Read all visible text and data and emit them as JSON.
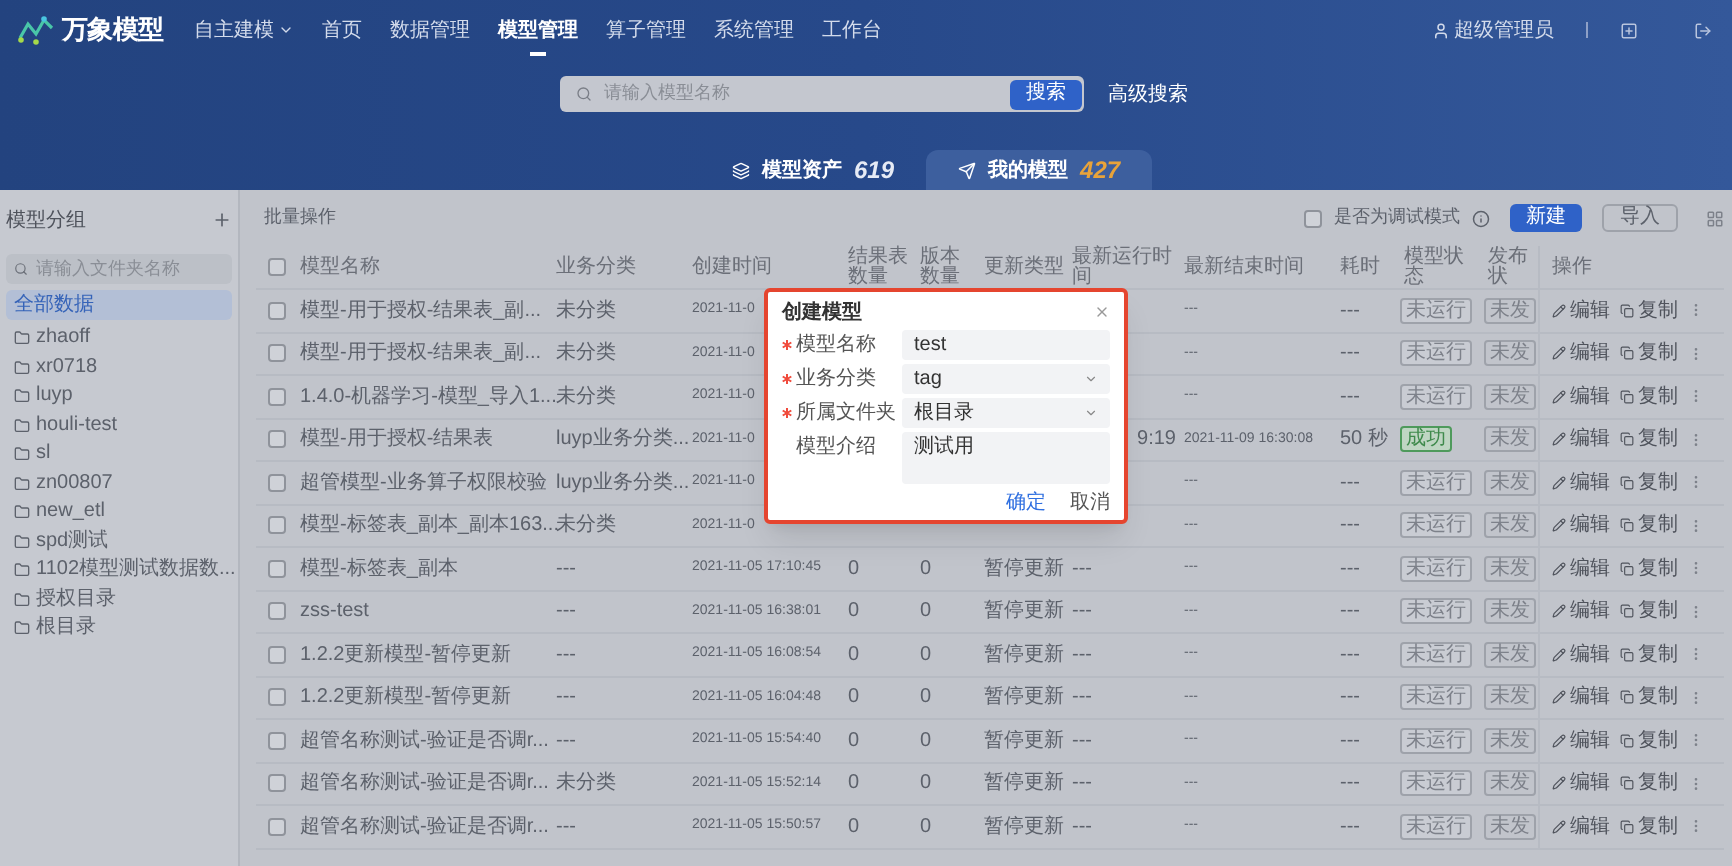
{
  "header": {
    "logo": "万象模型",
    "nav": [
      {
        "label": "自主建模",
        "dropdown": true,
        "selected": false
      },
      {
        "label": "首页",
        "dropdown": false,
        "selected": false
      },
      {
        "label": "数据管理",
        "dropdown": false,
        "selected": false
      },
      {
        "label": "模型管理",
        "dropdown": false,
        "selected": true
      },
      {
        "label": "算子管理",
        "dropdown": false,
        "selected": false
      },
      {
        "label": "系统管理",
        "dropdown": false,
        "selected": false
      },
      {
        "label": "工作台",
        "dropdown": false,
        "selected": false
      }
    ],
    "user": "超级管理员"
  },
  "search": {
    "placeholder": "请输入模型名称",
    "button": "搜索",
    "advanced": "高级搜索"
  },
  "asset_tabs": [
    {
      "label": "模型资产",
      "count": "619",
      "kind": "assets",
      "selected": false
    },
    {
      "label": "我的模型",
      "count": "427",
      "kind": "mine",
      "selected": true
    }
  ],
  "sidebar": {
    "title": "模型分组",
    "search_placeholder": "请输入文件夹名称",
    "items": [
      {
        "label": "全部数据",
        "kind": "all",
        "selected": true
      },
      {
        "label": "zhaoff",
        "kind": "folder",
        "selected": false
      },
      {
        "label": "xr0718",
        "kind": "folder",
        "selected": false
      },
      {
        "label": "luyp",
        "kind": "folder",
        "selected": false
      },
      {
        "label": "houli-test",
        "kind": "folder",
        "selected": false
      },
      {
        "label": "sl",
        "kind": "folder",
        "selected": false
      },
      {
        "label": "zn00807",
        "kind": "folder",
        "selected": false
      },
      {
        "label": "new_etl",
        "kind": "folder",
        "selected": false
      },
      {
        "label": "spd测试",
        "kind": "folder",
        "selected": false
      },
      {
        "label": "1102模型测试数据数...",
        "kind": "folder",
        "selected": false
      },
      {
        "label": "授权目录",
        "kind": "folder",
        "selected": false
      },
      {
        "label": "根目录",
        "kind": "folder",
        "selected": false
      }
    ]
  },
  "toolbar": {
    "batch": "批量操作",
    "debug_mode": {
      "label": "是否为调试模式",
      "checked": false
    },
    "buttons": [
      {
        "label": "新建",
        "kind": "primary"
      },
      {
        "label": "导入",
        "kind": "default"
      }
    ]
  },
  "table": {
    "all_checked": false,
    "columns": [
      "模型名称",
      "业务分类",
      "创建时间",
      "结果表数量",
      "版本数量",
      "更新类型",
      "最新运行时间",
      "最新结束时间",
      "耗时",
      "模型状态",
      "发布状",
      "操作"
    ],
    "rows": [
      {
        "checked": false,
        "name": "模型-用于授权-结果表_副...",
        "category": "未分类",
        "created": "2021-11-0",
        "last_end": "---",
        "duration": "---",
        "status": {
          "label": "未运行",
          "kind": "idle"
        },
        "publish": "未发",
        "actions": [
          "编辑",
          "复制"
        ]
      },
      {
        "checked": false,
        "name": "模型-用于授权-结果表_副...",
        "category": "未分类",
        "created": "2021-11-0",
        "last_end": "---",
        "duration": "---",
        "status": {
          "label": "未运行",
          "kind": "idle"
        },
        "publish": "未发",
        "actions": [
          "编辑",
          "复制"
        ]
      },
      {
        "checked": false,
        "name": "1.4.0-机器学习-模型_导入1...",
        "category": "未分类",
        "created": "2021-11-0",
        "last_end": "---",
        "duration": "---",
        "status": {
          "label": "未运行",
          "kind": "idle"
        },
        "publish": "未发",
        "actions": [
          "编辑",
          "复制"
        ]
      },
      {
        "checked": false,
        "name": "模型-用于授权-结果表",
        "category": "luyp业务分类...",
        "created": "2021-11-0",
        "last_run": "9:19",
        "last_end": "2021-11-09 16:30:08",
        "duration": "50 秒",
        "status": {
          "label": "成功",
          "kind": "success"
        },
        "publish": "未发",
        "actions": [
          "编辑",
          "复制"
        ]
      },
      {
        "checked": false,
        "name": "超管模型-业务算子权限校验",
        "category": "luyp业务分类...",
        "created": "2021-11-0",
        "last_end": "---",
        "duration": "---",
        "status": {
          "label": "未运行",
          "kind": "idle"
        },
        "publish": "未发",
        "actions": [
          "编辑",
          "复制"
        ]
      },
      {
        "checked": false,
        "name": "模型-标签表_副本_副本163...",
        "category": "未分类",
        "created": "2021-11-0",
        "last_end": "---",
        "duration": "---",
        "status": {
          "label": "未运行",
          "kind": "idle"
        },
        "publish": "未发",
        "actions": [
          "编辑",
          "复制"
        ]
      },
      {
        "checked": false,
        "name": "模型-标签表_副本",
        "category": "---",
        "created": "2021-11-05 17:10:45",
        "result_count": "0",
        "version_count": "0",
        "update_type": "暂停更新",
        "last_run": "---",
        "last_end": "---",
        "duration": "---",
        "status": {
          "label": "未运行",
          "kind": "idle"
        },
        "publish": "未发",
        "actions": [
          "编辑",
          "复制"
        ]
      },
      {
        "checked": false,
        "name": "zss-test",
        "category": "---",
        "created": "2021-11-05 16:38:01",
        "result_count": "0",
        "version_count": "0",
        "update_type": "暂停更新",
        "last_run": "---",
        "last_end": "---",
        "duration": "---",
        "status": {
          "label": "未运行",
          "kind": "idle"
        },
        "publish": "未发",
        "actions": [
          "编辑",
          "复制"
        ]
      },
      {
        "checked": false,
        "name": "1.2.2更新模型-暂停更新",
        "category": "---",
        "created": "2021-11-05 16:08:54",
        "result_count": "0",
        "version_count": "0",
        "update_type": "暂停更新",
        "last_run": "---",
        "last_end": "---",
        "duration": "---",
        "status": {
          "label": "未运行",
          "kind": "idle"
        },
        "publish": "未发",
        "actions": [
          "编辑",
          "复制"
        ]
      },
      {
        "checked": false,
        "name": "1.2.2更新模型-暂停更新",
        "category": "---",
        "created": "2021-11-05 16:04:48",
        "result_count": "0",
        "version_count": "0",
        "update_type": "暂停更新",
        "last_run": "---",
        "last_end": "---",
        "duration": "---",
        "status": {
          "label": "未运行",
          "kind": "idle"
        },
        "publish": "未发",
        "actions": [
          "编辑",
          "复制"
        ]
      },
      {
        "checked": false,
        "name": "超管名称测试-验证是否调r...",
        "category": "---",
        "created": "2021-11-05 15:54:40",
        "result_count": "0",
        "version_count": "0",
        "update_type": "暂停更新",
        "last_run": "---",
        "last_end": "---",
        "duration": "---",
        "status": {
          "label": "未运行",
          "kind": "idle"
        },
        "publish": "未发",
        "actions": [
          "编辑",
          "复制"
        ]
      },
      {
        "checked": false,
        "name": "超管名称测试-验证是否调r...",
        "category": "未分类",
        "created": "2021-11-05 15:52:14",
        "result_count": "0",
        "version_count": "0",
        "update_type": "暂停更新",
        "last_run": "---",
        "last_end": "---",
        "duration": "---",
        "status": {
          "label": "未运行",
          "kind": "idle"
        },
        "publish": "未发",
        "actions": [
          "编辑",
          "复制"
        ]
      },
      {
        "checked": false,
        "name": "超管名称测试-验证是否调r...",
        "category": "---",
        "created": "2021-11-05 15:50:57",
        "result_count": "0",
        "version_count": "0",
        "update_type": "暂停更新",
        "last_run": "---",
        "last_end": "---",
        "duration": "---",
        "status": {
          "label": "未运行",
          "kind": "idle"
        },
        "publish": "未发",
        "actions": [
          "编辑",
          "复制"
        ]
      }
    ]
  },
  "dialog": {
    "title": "创建模型",
    "fields": [
      {
        "label": "模型名称",
        "required": true,
        "kind": "input",
        "value": "test"
      },
      {
        "label": "业务分类",
        "required": true,
        "kind": "select",
        "value": "tag"
      },
      {
        "label": "所属文件夹",
        "required": true,
        "kind": "select",
        "value": "根目录"
      },
      {
        "label": "模型介绍",
        "required": false,
        "kind": "textarea",
        "value": "测试用"
      }
    ],
    "buttons": [
      {
        "label": "确定",
        "kind": "primary"
      },
      {
        "label": "取消",
        "kind": "default"
      }
    ]
  }
}
